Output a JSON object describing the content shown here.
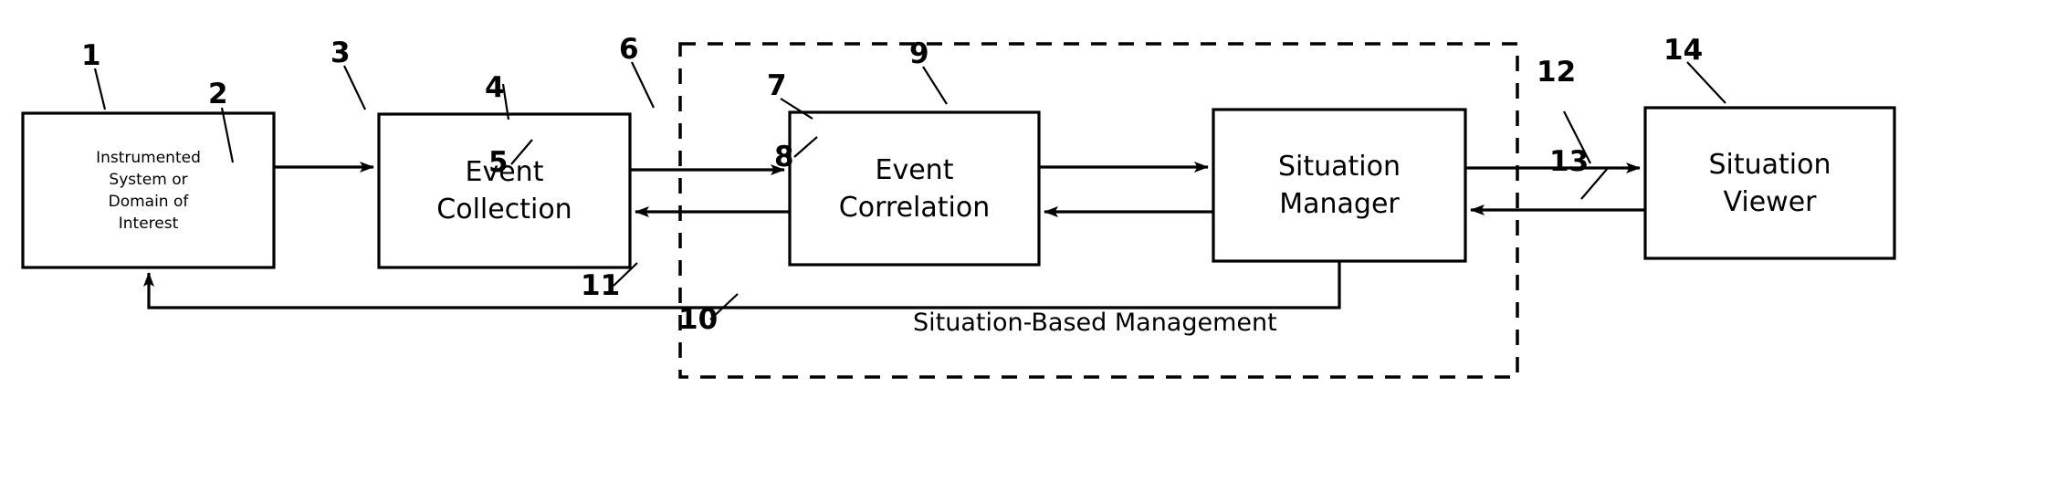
{
  "diagram": {
    "title_caption": "Situation-Based Management",
    "boxes": [
      {
        "id": "instrumented-system",
        "ref": "1",
        "lines": [
          "Instrumented",
          "System or",
          "Domain of",
          "Interest"
        ],
        "text_size": "small"
      },
      {
        "id": "event-collection",
        "ref": "3",
        "lines": [
          "Event",
          "Collection"
        ],
        "text_size": "large"
      },
      {
        "id": "event-correlation",
        "ref": "6",
        "lines": [
          "Event",
          "Correlation"
        ],
        "text_size": "large"
      },
      {
        "id": "situation-manager",
        "ref": "9",
        "lines": [
          "Situation",
          "Manager"
        ],
        "text_size": "large"
      },
      {
        "id": "situation-viewer",
        "ref": "14",
        "lines": [
          "Situation",
          "Viewer"
        ],
        "text_size": "large"
      }
    ],
    "reference_numerals": {
      "box1": "1",
      "arrow_sys_to_collection": "2",
      "box3": "3",
      "arrow_collection_to_correlation": "4",
      "arrow_correlation_to_collection": "5",
      "box6": "6",
      "arrow_correlation_to_manager": "7",
      "arrow_manager_to_correlation": "8",
      "box9": "9",
      "feedback_line": "10",
      "dashed_region": "11",
      "arrow_manager_to_viewer": "12",
      "arrow_viewer_to_manager": "13",
      "box14": "14"
    },
    "colors": {
      "stroke": "#000000",
      "background": "#ffffff",
      "text": "#000000"
    }
  }
}
